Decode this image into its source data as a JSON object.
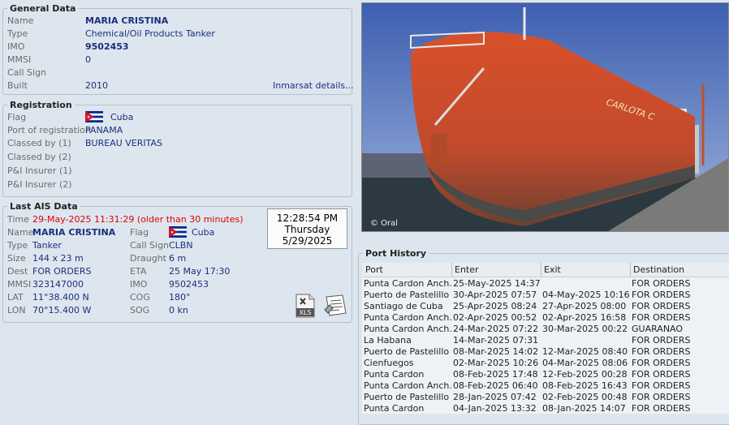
{
  "general": {
    "title": "General Data",
    "name_label": "Name",
    "name": "MARIA CRISTINA",
    "type_label": "Type",
    "type": "Chemical/Oil Products Tanker",
    "imo_label": "IMO",
    "imo": "9502453",
    "mmsi_label": "MMSI",
    "mmsi": "0",
    "callsign_label": "Call Sign",
    "callsign": "",
    "built_label": "Built",
    "built": "2010",
    "inmarsat_link": "Inmarsat details..."
  },
  "registration": {
    "title": "Registration",
    "flag_label": "Flag",
    "flag": "Cuba",
    "port_label": "Port of registration",
    "port": "PANAMA",
    "classed1_label": "Classed by (1)",
    "classed1": "BUREAU VERITAS",
    "classed2_label": "Classed by (2)",
    "classed2": "",
    "pi1_label": "P&I Insurer (1)",
    "pi1": "",
    "pi2_label": "P&I Insurer (2)",
    "pi2": ""
  },
  "ais": {
    "title": "Last AIS Data",
    "time_label": "Time",
    "time": "29-May-2025 11:31:29 (older than 30 minutes)",
    "name_label": "Name",
    "name": "MARIA CRISTINA",
    "flag_label": "Flag",
    "flag": "Cuba",
    "type_label": "Type",
    "type": "Tanker",
    "callsign_label": "Call Sign",
    "callsign": "CLBN",
    "size_label": "Size",
    "size": "144 x 23 m",
    "draught_label": "Draught",
    "draught": "6 m",
    "dest_label": "Dest",
    "dest": "FOR ORDERS",
    "eta_label": "ETA",
    "eta": "25 May 17:30",
    "mmsi_label": "MMSI",
    "mmsi": "323147000",
    "imo_label": "IMO",
    "imo": "9502453",
    "lat_label": "LAT",
    "lat": "11°38.400 N",
    "cog_label": "COG",
    "cog": "180°",
    "lon_label": "LON",
    "lon": "70°15.400 W",
    "sog_label": "SOG",
    "sog": "0 kn",
    "xls_label": "XLS"
  },
  "clock": {
    "time": "12:28:54 PM",
    "day": "Thursday",
    "date": "5/29/2025"
  },
  "photo": {
    "caption": "© Oral",
    "hull_name": "CARLOTA C"
  },
  "port_history": {
    "title": "Port History",
    "columns": [
      "Port",
      "Enter",
      "Exit",
      "Destination"
    ],
    "rows": [
      [
        "Punta Cardon Anch.",
        "25-May-2025 14:37",
        "",
        "FOR ORDERS"
      ],
      [
        "Puerto de Pastelillo",
        "30-Apr-2025 07:57",
        "04-May-2025 10:16",
        "FOR ORDERS"
      ],
      [
        "Santiago de Cuba",
        "25-Apr-2025 08:24",
        "27-Apr-2025 08:00",
        "FOR ORDERS"
      ],
      [
        "Punta Cardon Anch.",
        "02-Apr-2025 00:52",
        "02-Apr-2025 16:58",
        "FOR ORDERS"
      ],
      [
        "Punta Cardon Anch.",
        "24-Mar-2025 07:22",
        "30-Mar-2025 00:22",
        "GUARANAO"
      ],
      [
        "La Habana",
        "14-Mar-2025 07:31",
        "",
        "FOR ORDERS"
      ],
      [
        "Puerto de Pastelillo",
        "08-Mar-2025 14:02",
        "12-Mar-2025 08:40",
        "FOR ORDERS"
      ],
      [
        "Cienfuegos",
        "02-Mar-2025 10:26",
        "04-Mar-2025 08:06",
        "FOR ORDERS"
      ],
      [
        "Punta Cardon",
        "08-Feb-2025 17:48",
        "12-Feb-2025 00:28",
        "FOR ORDERS"
      ],
      [
        "Punta Cardon Anch.",
        "08-Feb-2025 06:40",
        "08-Feb-2025 16:43",
        "FOR ORDERS"
      ],
      [
        "Puerto de Pastelillo",
        "28-Jan-2025 07:42",
        "02-Feb-2025 00:48",
        "FOR ORDERS"
      ],
      [
        "Punta Cardon",
        "04-Jan-2025 13:32",
        "08-Jan-2025 14:07",
        "FOR ORDERS"
      ]
    ]
  }
}
